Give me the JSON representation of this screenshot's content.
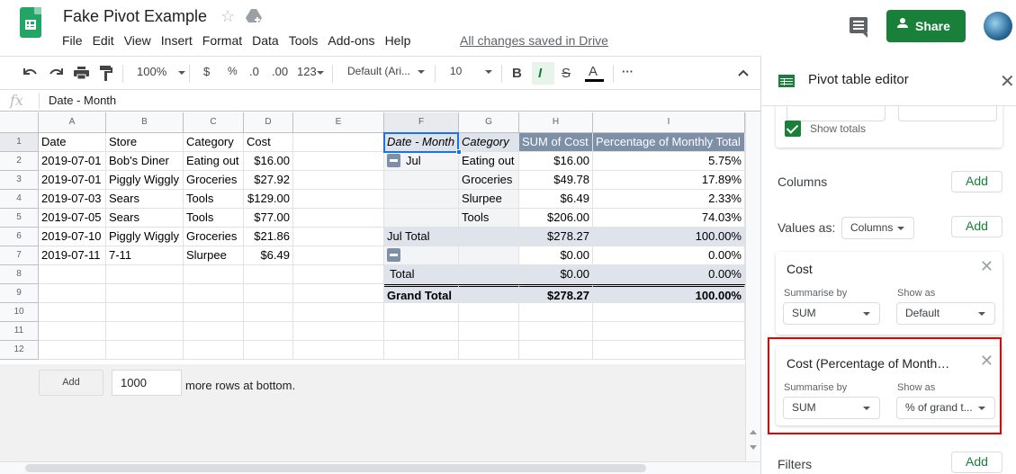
{
  "app": {
    "title": "Fake Pivot Example",
    "menu": [
      "File",
      "Edit",
      "View",
      "Insert",
      "Format",
      "Data",
      "Tools",
      "Add-ons",
      "Help"
    ],
    "save_status": "All changes saved in Drive",
    "share_label": "Share",
    "brand_color": "#188038"
  },
  "toolbar": {
    "zoom": "100%",
    "currency": "$",
    "percent": "%",
    "decrease_decimals": ".0",
    "increase_decimals": ".00",
    "more_formats": "123",
    "font": "Default (Ari...",
    "font_size": "10",
    "bold": "B",
    "italic": "I",
    "strikethrough": "S",
    "text_color": "A",
    "more": "···"
  },
  "formula_bar": {
    "fx": "fx",
    "value": "Date - Month"
  },
  "grid": {
    "columns": [
      "A",
      "B",
      "C",
      "D",
      "E",
      "F",
      "G",
      "H",
      "I"
    ],
    "rows": [
      "1",
      "2",
      "3",
      "4",
      "5",
      "6",
      "7",
      "8",
      "9",
      "10",
      "11",
      "12"
    ],
    "source_table": {
      "headers": [
        "Date",
        "Store",
        "Category",
        "Cost"
      ],
      "rows": [
        [
          "2019-07-01",
          "Bob's Diner",
          "Eating out",
          "$16.00"
        ],
        [
          "2019-07-01",
          "Piggly Wiggly",
          "Groceries",
          "$27.92"
        ],
        [
          "2019-07-03",
          "Sears",
          "Tools",
          "$129.00"
        ],
        [
          "2019-07-05",
          "Sears",
          "Tools",
          "$77.00"
        ],
        [
          "2019-07-10",
          "Piggly Wiggly",
          "Groceries",
          "$21.86"
        ],
        [
          "2019-07-11",
          "7-11",
          "Slurpee",
          "$6.49"
        ]
      ]
    },
    "pivot_table": {
      "headers": [
        "Date - Month",
        "Category",
        "SUM of Cost",
        "Percentage of Monthly Total"
      ],
      "rows": [
        [
          "Jul",
          "Eating out",
          "$16.00",
          "5.75%"
        ],
        [
          "",
          "Groceries",
          "$49.78",
          "17.89%"
        ],
        [
          "",
          "Slurpee",
          "$6.49",
          "2.33%"
        ],
        [
          "",
          "Tools",
          "$206.00",
          "74.03%"
        ],
        [
          "Jul Total",
          "",
          "$278.27",
          "100.00%"
        ],
        [
          "",
          "",
          "$0.00",
          "0.00%"
        ],
        [
          "Total",
          "",
          "$0.00",
          "0.00%"
        ],
        [
          "Grand Total",
          "",
          "$278.27",
          "100.00%"
        ]
      ]
    },
    "add_rows": {
      "button": "Add",
      "value": "1000",
      "suffix": "more rows at bottom."
    }
  },
  "pivot_editor": {
    "title": "Pivot table editor",
    "show_totals": "Show totals",
    "show_totals_checked": true,
    "columns_label": "Columns",
    "add_label": "Add",
    "values_as_label": "Values as:",
    "values_as_value": "Columns",
    "value_cards": [
      {
        "title": "Cost",
        "summarise_label": "Summarise by",
        "summarise_value": "SUM",
        "show_as_label": "Show as",
        "show_as_value": "Default"
      },
      {
        "title": "Cost (Percentage of Month…",
        "summarise_label": "Summarise by",
        "summarise_value": "SUM",
        "show_as_label": "Show as",
        "show_as_value": "% of grand t..."
      }
    ],
    "filters_label": "Filters"
  }
}
